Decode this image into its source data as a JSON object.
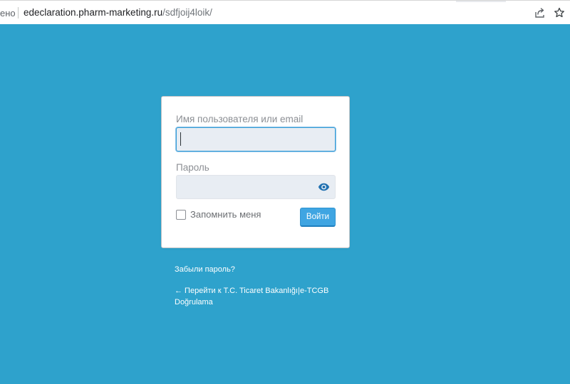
{
  "browser": {
    "security_label": "ено",
    "url_host": "edeclaration.pharm-marketing.ru",
    "url_path": "/sdfjoij4loik/",
    "icons": [
      "share-icon",
      "star-icon"
    ]
  },
  "login": {
    "username_label": "Имя пользователя или email",
    "username_value": "",
    "password_label": "Пароль",
    "password_value": "",
    "remember_label": "Запомнить меня",
    "submit_label": "Войти"
  },
  "links": {
    "lost_password": "Забыли пароль?",
    "back_to_site": "← Перейти к T.C. Ticaret Bakanlığı|e-TCGB Doğrulama"
  },
  "colors": {
    "background": "#2ea2cc",
    "button": "#3fa5e2",
    "focus_border": "#3a9fd8"
  }
}
